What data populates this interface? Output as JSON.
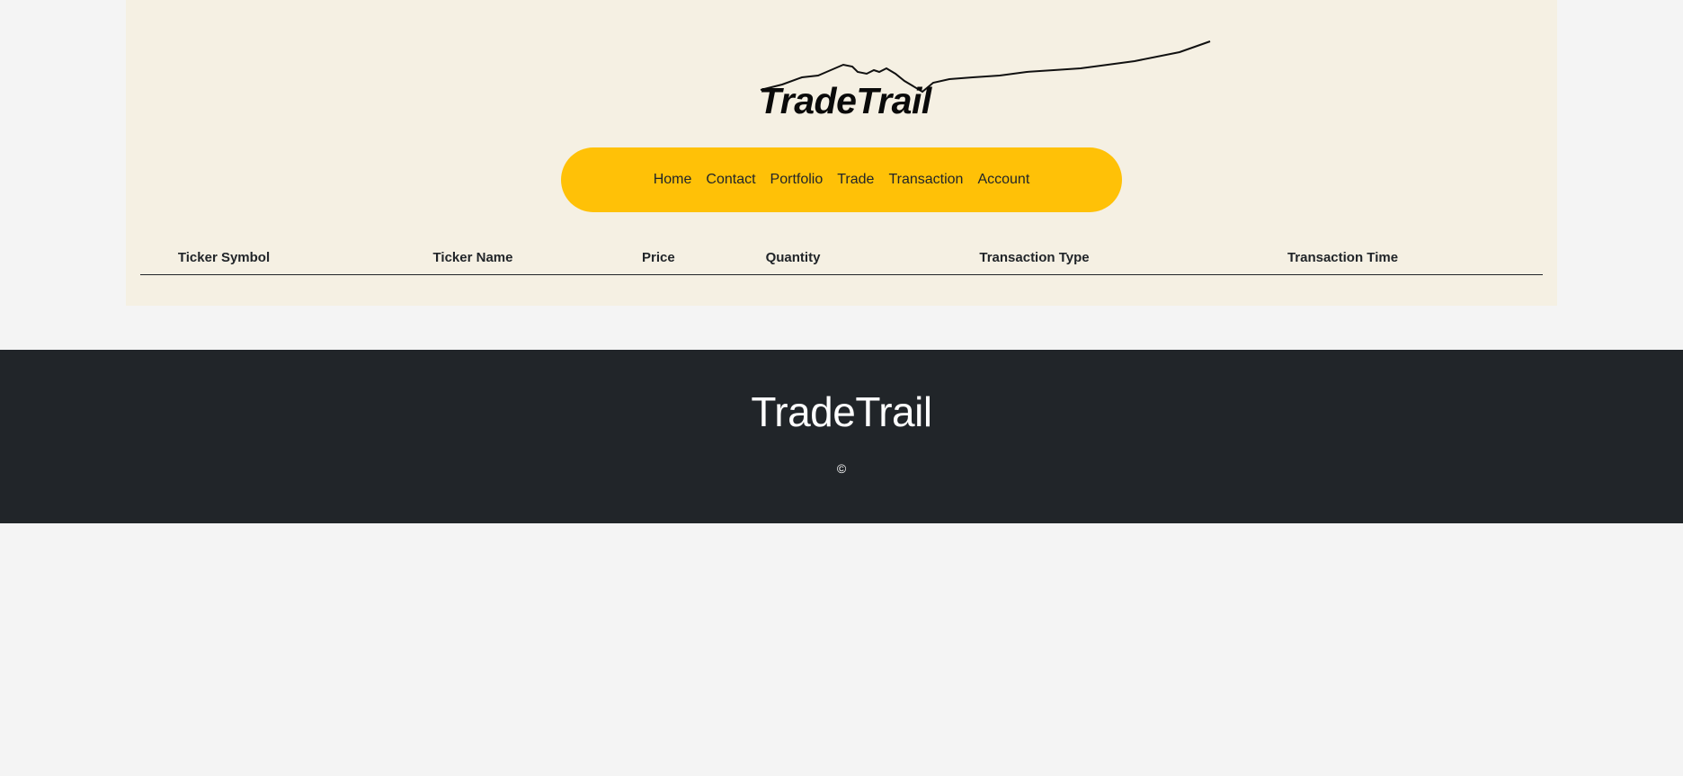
{
  "header": {
    "logo_text": "TradeTrail"
  },
  "nav": {
    "items": [
      {
        "label": "Home"
      },
      {
        "label": "Contact"
      },
      {
        "label": "Portfolio"
      },
      {
        "label": "Trade"
      },
      {
        "label": "Transaction"
      },
      {
        "label": "Account"
      }
    ]
  },
  "table": {
    "columns": [
      "Ticker Symbol",
      "Ticker Name",
      "Price",
      "Quantity",
      "Transaction Type",
      "Transaction Time"
    ],
    "rows": []
  },
  "footer": {
    "brand": "TradeTrail",
    "copyright": "©"
  },
  "colors": {
    "panel_background": "#f5f0e3",
    "nav_background": "#ffc107",
    "footer_background": "#212529",
    "page_background": "#f4f4f4"
  }
}
